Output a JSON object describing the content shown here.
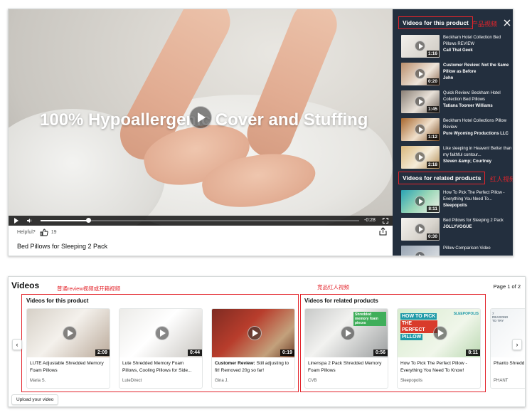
{
  "player": {
    "overlay_text": "100% Hypoallergenic Cover and Stuffing",
    "time_left": "-0:28",
    "progress": 0.15,
    "helpful_label": "Helpful?",
    "helpful_count": "19",
    "product_title": "Bed Pillows for Sleeping 2 Pack"
  },
  "sidebar": {
    "product_heading": "Videos for this product",
    "product_annotation": "产品视频",
    "related_heading": "Videos for related products",
    "related_annotation": "红人视频",
    "product_videos": [
      {
        "title": "Beckham Hotel Collection Bed Pillows REVIEW",
        "creator": "Call That Geek",
        "duration": "1:16",
        "bold": false
      },
      {
        "title": "Customer Review: Not the Same Pillow as Before",
        "creator": "John",
        "duration": "0:20",
        "bold": true
      },
      {
        "title": "Quick Review: Beckham Hotel Collection Bed Pillows",
        "creator": "Tatiana Toomer Williams",
        "duration": "1:45",
        "bold": false
      },
      {
        "title": "Beckham Hotel Collections Pillow Review",
        "creator": "Pure Wyoming Productions LLC",
        "duration": "1:12",
        "bold": false
      },
      {
        "title": "Like sleeping in Heaven! Better than my faithful contour...",
        "creator": "Steven &amp; Courtney",
        "duration": "2:18",
        "bold": false
      }
    ],
    "related_videos": [
      {
        "title": "How To Pick The Perfect Pillow - Everything You Need To...",
        "creator": "Sleepopolis",
        "duration": "8:11"
      },
      {
        "title": "Bed Pillows for Sleeping 2 Pack",
        "creator": "JOLLYVOGUE",
        "duration": "0:30"
      },
      {
        "title": "Pillow Comparison Video",
        "creator": "",
        "duration": ""
      }
    ]
  },
  "bottom": {
    "title": "Videos",
    "page_indicator": "Page 1 of 2",
    "annotation_left": "普通review视频或开箱视频",
    "annotation_right": "竞品红人视频",
    "group_this": "Videos for this product",
    "group_related": "Videos for related products",
    "upload_label": "Upload your video",
    "prev_arrow": "‹",
    "next_arrow": "›",
    "cards": [
      {
        "title": "LUTE Adjustable Shredded Memory Foam Pillows",
        "prefix": "",
        "creator": "Maria S.",
        "duration": "2:09"
      },
      {
        "title": "Lute Shredded Memory Foam Pillows, Cooling Pillows for Side...",
        "prefix": "",
        "creator": "LuteDirect",
        "duration": "0:44"
      },
      {
        "title": " Still adjusting to fit! Removed 20g so far!",
        "prefix": "Customer Review:",
        "creator": "Gina J.",
        "duration": "0:19"
      },
      {
        "title": "Linenspa 2 Pack Shredded Memory Foam Pillows",
        "prefix": "",
        "creator": "CVB",
        "duration": "0:56",
        "tag": "Shredded memory foam pieces"
      },
      {
        "title": "How To Pick The Perfect Pillow - Everything You Need To Know!",
        "prefix": "",
        "creator": "Sleepopolis",
        "duration": "8:11",
        "banner": [
          "HOW TO PICK",
          "THE PERFECT",
          "PILLOW"
        ],
        "banner_tag": "SLEEPOPOLIS"
      },
      {
        "title": "Phanto Shredd",
        "prefix": "",
        "creator": "PHANT",
        "duration": "",
        "banner_tag": "7 REASONS TO TRY"
      }
    ]
  },
  "colors": {
    "sidebar_bg": "#232f3e",
    "annotation_red": "#e3242b",
    "banner_red": "#d93b2b",
    "banner_teal": "#1f9aa8"
  }
}
